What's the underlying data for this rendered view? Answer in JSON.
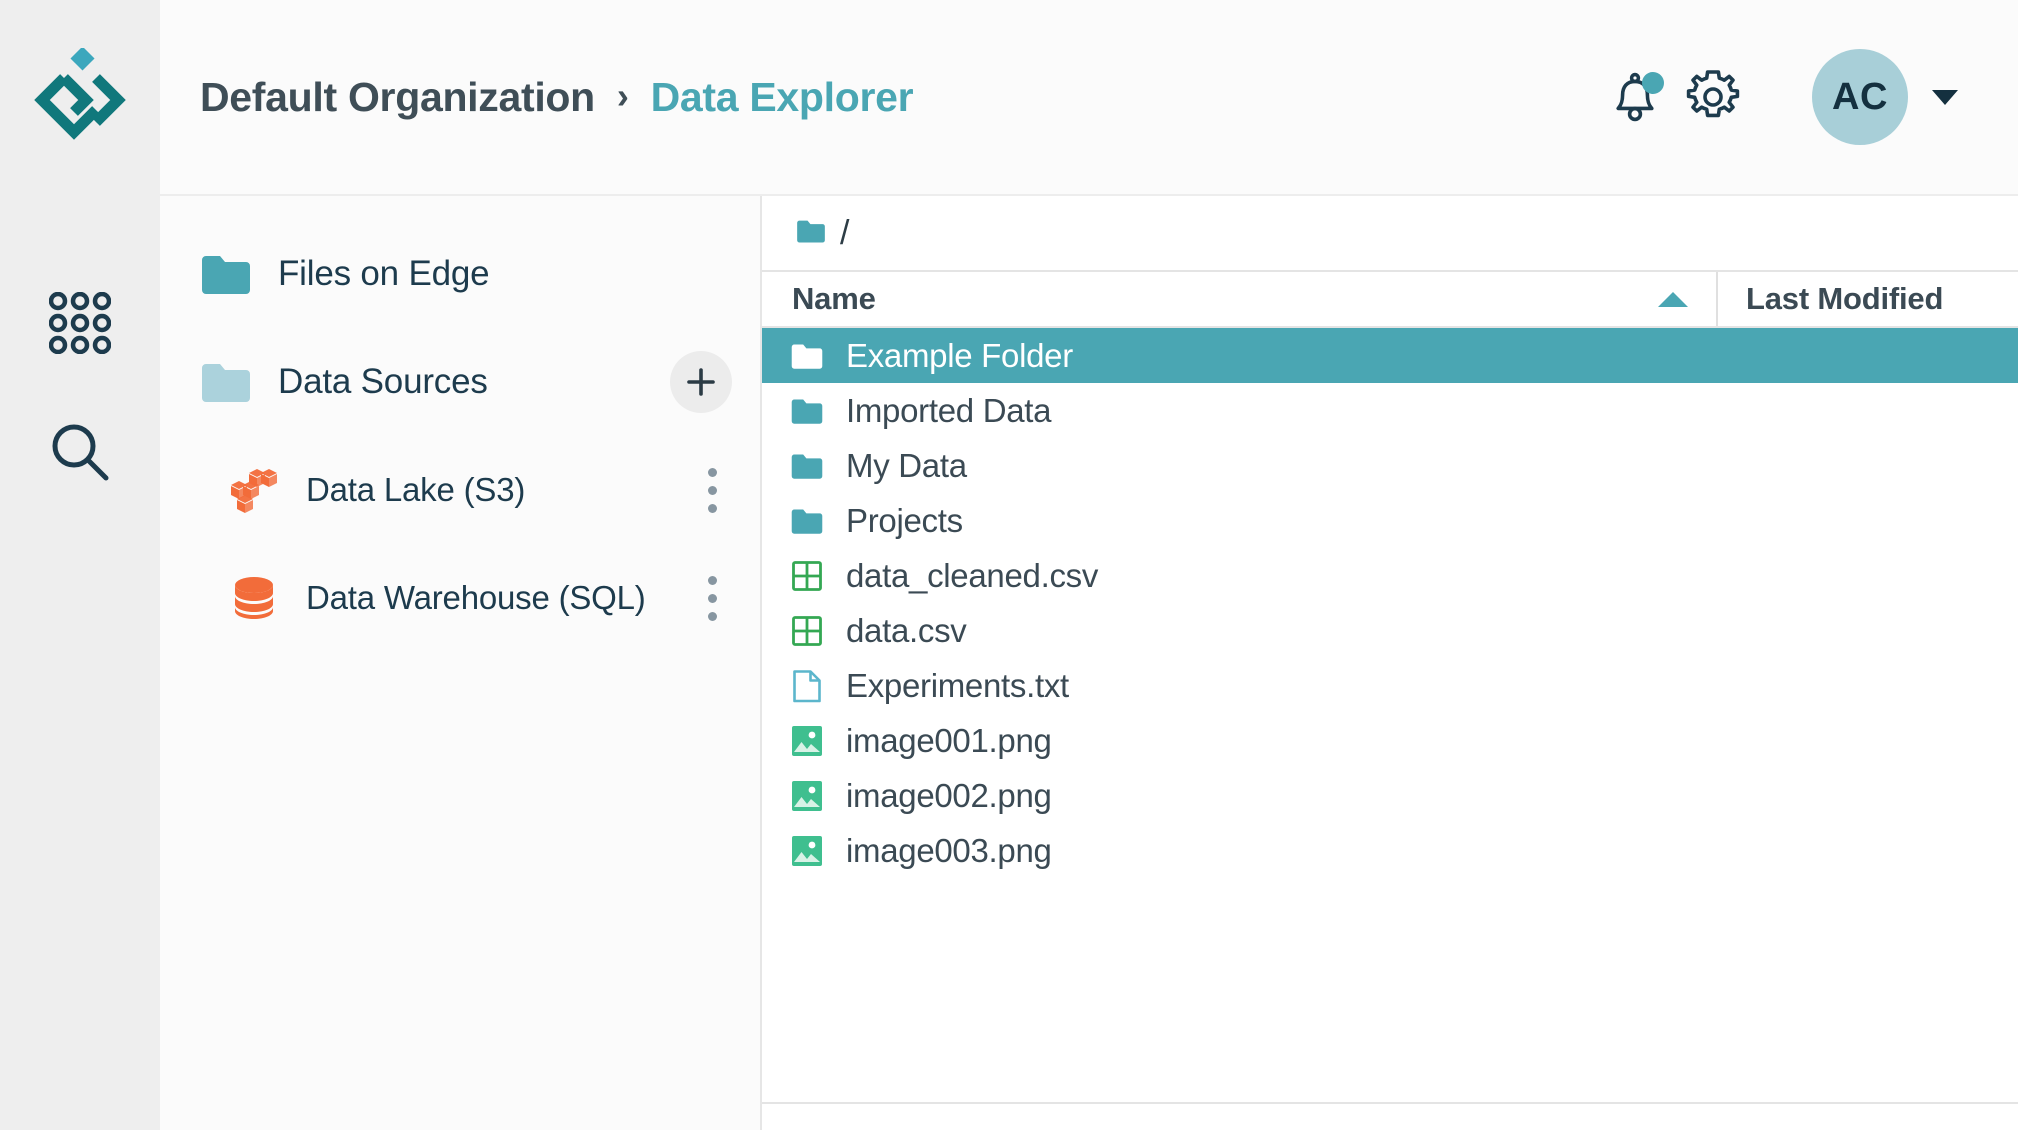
{
  "theme": {
    "accent_teal": "#4aa6b3",
    "dark_navy": "#1d3b4d",
    "logo_teal": "#10787c",
    "orange": "#f26c3a",
    "green": "#34a853",
    "rail_bg": "#eeeeee",
    "panel_bg": "#fbfbfb",
    "selected_row_bg": "#4aa6b3"
  },
  "rail": {
    "logo_name": "app-logo",
    "items": [
      {
        "icon": "apps-grid-icon",
        "label": "Apps"
      },
      {
        "icon": "search-icon",
        "label": "Search"
      }
    ]
  },
  "header": {
    "breadcrumb": {
      "organization": "Default Organization",
      "separator": "›",
      "current": "Data Explorer"
    },
    "notifications_icon": "bell-icon",
    "has_notification": true,
    "settings_icon": "gear-icon",
    "avatar_initials": "AC",
    "caret_icon": "chevron-down-icon"
  },
  "sidebar": {
    "items": [
      {
        "label": "Files on Edge",
        "icon": "folder-icon",
        "icon_color": "#4aa6b3",
        "level": 0,
        "action": null
      },
      {
        "label": "Data Sources",
        "icon": "folder-icon",
        "icon_color": "#abd2dc",
        "level": 0,
        "action": "add-button",
        "action_label": "+"
      },
      {
        "label": "Data Lake (S3)",
        "icon": "s3-cubes-icon",
        "icon_color": "#f26c3a",
        "level": 1,
        "action": "kebab-menu"
      },
      {
        "label": "Data Warehouse (SQL)",
        "icon": "database-icon",
        "icon_color": "#f26c3a",
        "level": 1,
        "action": "kebab-menu"
      }
    ]
  },
  "file_browser": {
    "path_icon": "folder-icon",
    "path": "/",
    "columns": [
      {
        "key": "name",
        "label": "Name",
        "sorted": true,
        "sort_direction": "asc"
      },
      {
        "key": "modified",
        "label": "Last Modified",
        "sorted": false
      }
    ],
    "rows": [
      {
        "name": "Example Folder",
        "icon": "folder-icon",
        "type": "folder",
        "selected": true
      },
      {
        "name": "Imported Data",
        "icon": "folder-icon",
        "type": "folder",
        "selected": false
      },
      {
        "name": "My Data",
        "icon": "folder-icon",
        "type": "folder",
        "selected": false
      },
      {
        "name": "Projects",
        "icon": "folder-icon",
        "type": "folder",
        "selected": false
      },
      {
        "name": "data_cleaned.csv",
        "icon": "csv-grid-icon",
        "type": "csv",
        "selected": false
      },
      {
        "name": "data.csv",
        "icon": "csv-grid-icon",
        "type": "csv",
        "selected": false
      },
      {
        "name": "Experiments.txt",
        "icon": "document-icon",
        "type": "text",
        "selected": false
      },
      {
        "name": "image001.png",
        "icon": "image-icon",
        "type": "image",
        "selected": false
      },
      {
        "name": "image002.png",
        "icon": "image-icon",
        "type": "image",
        "selected": false
      },
      {
        "name": "image003.png",
        "icon": "image-icon",
        "type": "image",
        "selected": false
      }
    ]
  }
}
